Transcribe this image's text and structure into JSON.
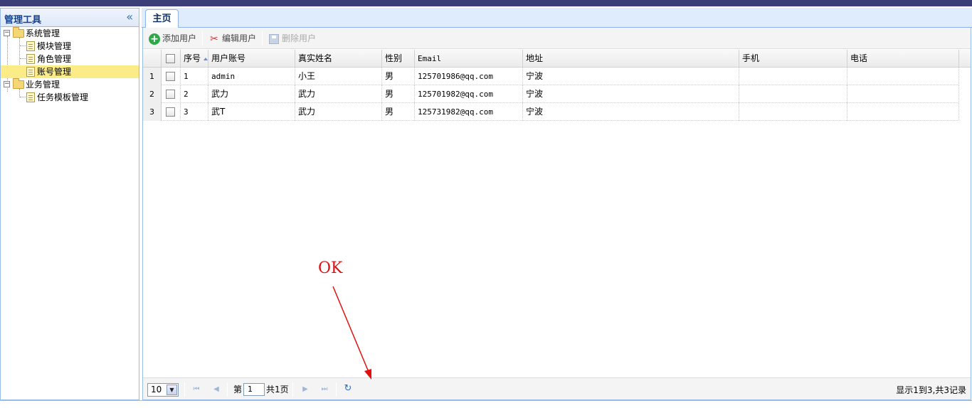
{
  "sidebar": {
    "title": "管理工具",
    "collapse_icon": "«",
    "tree": {
      "system": {
        "label": "系统管理",
        "children": [
          "模块管理",
          "角色管理",
          "账号管理"
        ]
      },
      "business": {
        "label": "业务管理",
        "children": [
          "任务模板管理"
        ]
      },
      "selected": "账号管理"
    }
  },
  "tabs": [
    {
      "label": "主页"
    }
  ],
  "toolbar": {
    "add_label": "添加用户",
    "edit_label": "编辑用户",
    "delete_label": "删除用户"
  },
  "grid": {
    "headers": [
      "序号",
      "用户账号",
      "真实姓名",
      "性别",
      "Email",
      "地址",
      "手机",
      "电话"
    ],
    "rows": [
      {
        "rownum": "1",
        "id": "1",
        "account": "admin",
        "name": "小王",
        "gender": "男",
        "email": "125701986@qq.com",
        "address": "宁波",
        "mobile": "",
        "phone": ""
      },
      {
        "rownum": "2",
        "id": "2",
        "account": "武力",
        "name": "武力",
        "gender": "男",
        "email": "125701982@qq.com",
        "address": "宁波",
        "mobile": "",
        "phone": ""
      },
      {
        "rownum": "3",
        "id": "3",
        "account": "武T",
        "name": "武力",
        "gender": "男",
        "email": "125731982@qq.com",
        "address": "宁波",
        "mobile": "",
        "phone": ""
      }
    ]
  },
  "pager": {
    "page_size": "10",
    "page_prefix": "第",
    "current_page": "1",
    "total_pages": "共1页",
    "info": "显示1到3,共3记录"
  },
  "annotation": {
    "text": "OK",
    "color": "#e01010"
  }
}
